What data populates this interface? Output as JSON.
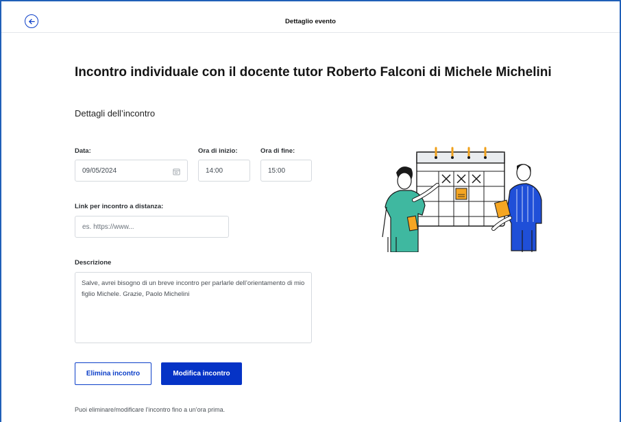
{
  "header": {
    "title": "Dettaglio evento",
    "back_icon": "arrow-left-circle-icon"
  },
  "page": {
    "title": "Incontro individuale con il docente tutor Roberto Falconi di Michele Michelini",
    "section_title": "Dettagli dell’incontro"
  },
  "form": {
    "date": {
      "label": "Data:",
      "value": "09/05/2024",
      "icon": "calendar-icon"
    },
    "start_time": {
      "label": "Ora di inizio:",
      "value": "14:00"
    },
    "end_time": {
      "label": "Ora di fine:",
      "value": "15:00"
    },
    "link": {
      "label": "Link per incontro a distanza:",
      "placeholder": "es. https://www..."
    },
    "description": {
      "label": "Descrizione",
      "value": "Salve, avrei bisogno di un breve incontro per parlarle dell’orientamento di mio figlio Michele. Grazie, Paolo Michelini"
    }
  },
  "actions": {
    "delete_label": "Elimina incontro",
    "edit_label": "Modifica incontro"
  },
  "footnote": "Puoi eliminare/modificare l’incontro fino a un’ora prima.",
  "colors": {
    "primary": "#0533c6",
    "border": "#d5d9de",
    "illustration_green": "#3fb8a0",
    "illustration_blue": "#1f4fd8",
    "illustration_orange": "#f5a623"
  }
}
